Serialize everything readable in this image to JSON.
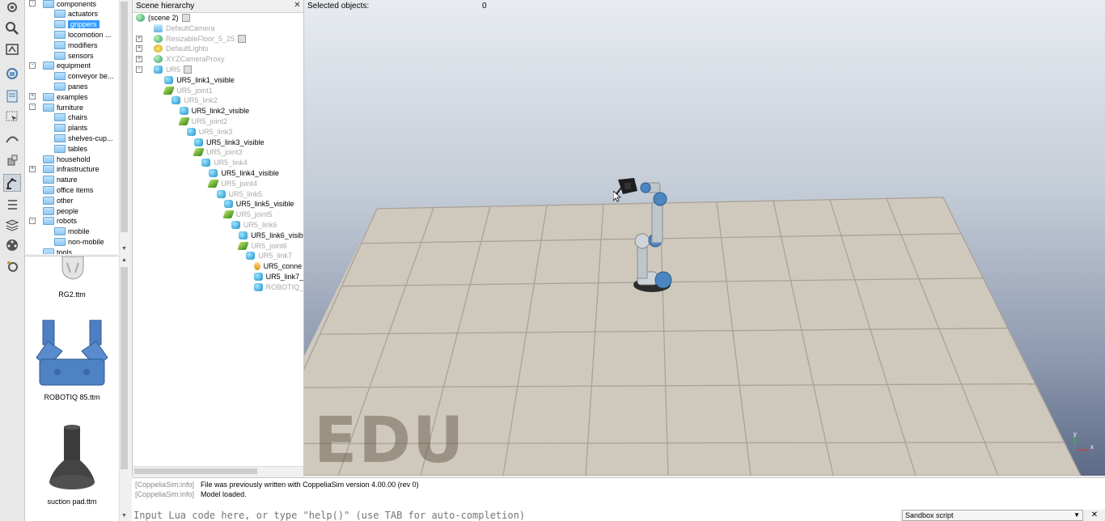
{
  "model_tree": {
    "items": [
      {
        "label": "components",
        "depth": 1,
        "expander": "-"
      },
      {
        "label": "actuators",
        "depth": 2
      },
      {
        "label": "grippers",
        "depth": 2,
        "selected": true
      },
      {
        "label": "locomotion ...",
        "depth": 2
      },
      {
        "label": "modifiers",
        "depth": 2
      },
      {
        "label": "sensors",
        "depth": 2
      },
      {
        "label": "equipment",
        "depth": 1,
        "expander": "-"
      },
      {
        "label": "conveyor be...",
        "depth": 2
      },
      {
        "label": "panes",
        "depth": 2
      },
      {
        "label": "examples",
        "depth": 1,
        "expander": "+"
      },
      {
        "label": "furniture",
        "depth": 1,
        "expander": "-"
      },
      {
        "label": "chairs",
        "depth": 2
      },
      {
        "label": "plants",
        "depth": 2
      },
      {
        "label": "shelves-cup...",
        "depth": 2
      },
      {
        "label": "tables",
        "depth": 2
      },
      {
        "label": "household",
        "depth": 1
      },
      {
        "label": "infrastructure",
        "depth": 1,
        "expander": "+"
      },
      {
        "label": "nature",
        "depth": 1
      },
      {
        "label": "office items",
        "depth": 1
      },
      {
        "label": "other",
        "depth": 1
      },
      {
        "label": "people",
        "depth": 1
      },
      {
        "label": "robots",
        "depth": 1,
        "expander": "-"
      },
      {
        "label": "mobile",
        "depth": 2
      },
      {
        "label": "non-mobile",
        "depth": 2
      },
      {
        "label": "tools",
        "depth": 1
      }
    ]
  },
  "model_thumbs": {
    "items": [
      {
        "label": "RG2.ttm"
      },
      {
        "label": "ROBOTIQ 85.ttm"
      },
      {
        "label": "suction pad.ttm"
      }
    ]
  },
  "hierarchy": {
    "title": "Scene hierarchy",
    "rows": [
      {
        "label": "(scene 2)",
        "icon": "scene",
        "depth": 0,
        "dim": false,
        "script": true
      },
      {
        "label": "DefaultCamera",
        "icon": "camera",
        "depth": 1,
        "dim": true
      },
      {
        "label": "ResizableFloor_5_25",
        "icon": "scene",
        "depth": 1,
        "dim": true,
        "script": true
      },
      {
        "label": "DefaultLights",
        "icon": "light",
        "depth": 1,
        "dim": true
      },
      {
        "label": "XYZCameraProxy",
        "icon": "scene",
        "depth": 1,
        "dim": true
      },
      {
        "label": "UR5",
        "icon": "shape",
        "depth": 1,
        "dim": true,
        "script": true
      },
      {
        "label": "UR5_link1_visible",
        "icon": "shape",
        "depth": 2,
        "dim": false
      },
      {
        "label": "UR5_joint1",
        "icon": "joint",
        "depth": 2,
        "dim": true
      },
      {
        "label": "UR5_link2",
        "icon": "shape",
        "depth": 3,
        "dim": true
      },
      {
        "label": "UR5_link2_visible",
        "icon": "shape",
        "depth": 4,
        "dim": false
      },
      {
        "label": "UR5_joint2",
        "icon": "joint",
        "depth": 4,
        "dim": true
      },
      {
        "label": "UR5_link3",
        "icon": "shape",
        "depth": 5,
        "dim": true
      },
      {
        "label": "UR5_link3_visible",
        "icon": "shape",
        "depth": 6,
        "dim": false
      },
      {
        "label": "UR5_joint3",
        "icon": "joint",
        "depth": 6,
        "dim": true
      },
      {
        "label": "UR5_link4",
        "icon": "shape",
        "depth": 7,
        "dim": true
      },
      {
        "label": "UR5_link4_visible",
        "icon": "shape",
        "depth": 8,
        "dim": false
      },
      {
        "label": "UR5_joint4",
        "icon": "joint",
        "depth": 8,
        "dim": true
      },
      {
        "label": "UR5_link5",
        "icon": "shape",
        "depth": 9,
        "dim": true
      },
      {
        "label": "UR5_link5_visible",
        "icon": "shape",
        "depth": 10,
        "dim": false
      },
      {
        "label": "UR5_joint5",
        "icon": "joint",
        "depth": 10,
        "dim": true
      },
      {
        "label": "UR5_link6",
        "icon": "shape",
        "depth": 11,
        "dim": true
      },
      {
        "label": "UR5_link6_visib",
        "icon": "shape",
        "depth": 12,
        "dim": false
      },
      {
        "label": "UR5_joint6",
        "icon": "joint",
        "depth": 12,
        "dim": true
      },
      {
        "label": "UR5_link7",
        "icon": "shape",
        "depth": 13,
        "dim": true
      },
      {
        "label": "UR5_conne",
        "icon": "dummy",
        "depth": 14,
        "dim": false
      },
      {
        "label": "UR5_link7_",
        "icon": "shape",
        "depth": 14,
        "dim": false
      },
      {
        "label": "ROBOTIQ_",
        "icon": "shape",
        "depth": 14,
        "dim": true
      }
    ]
  },
  "viewport": {
    "selected_label": "Selected objects:",
    "selected_count": "0",
    "watermark": "EDU",
    "axis_y": "y",
    "axis_x": "x"
  },
  "console": {
    "lines": [
      {
        "tag": "[CoppeliaSim:info]",
        "text": "File was previously written with CoppeliaSim version 4.00.00 (rev 0)"
      },
      {
        "tag": "[CoppeliaSim:info]",
        "text": "Model loaded."
      }
    ],
    "input_placeholder": "Input Lua code here, or type \"help()\" (use TAB for auto-completion)",
    "script_selector": "Sandbox script"
  },
  "toolbar_icons": [
    "gear-icon",
    "zoom-icon",
    "fit-view-icon",
    "camera-rotate-icon",
    "page-icon",
    "selection-icon",
    "path-icon",
    "object-move-icon",
    "robot-arm-icon",
    "list-icon",
    "layers-icon",
    "film-icon",
    "settings-icon"
  ]
}
